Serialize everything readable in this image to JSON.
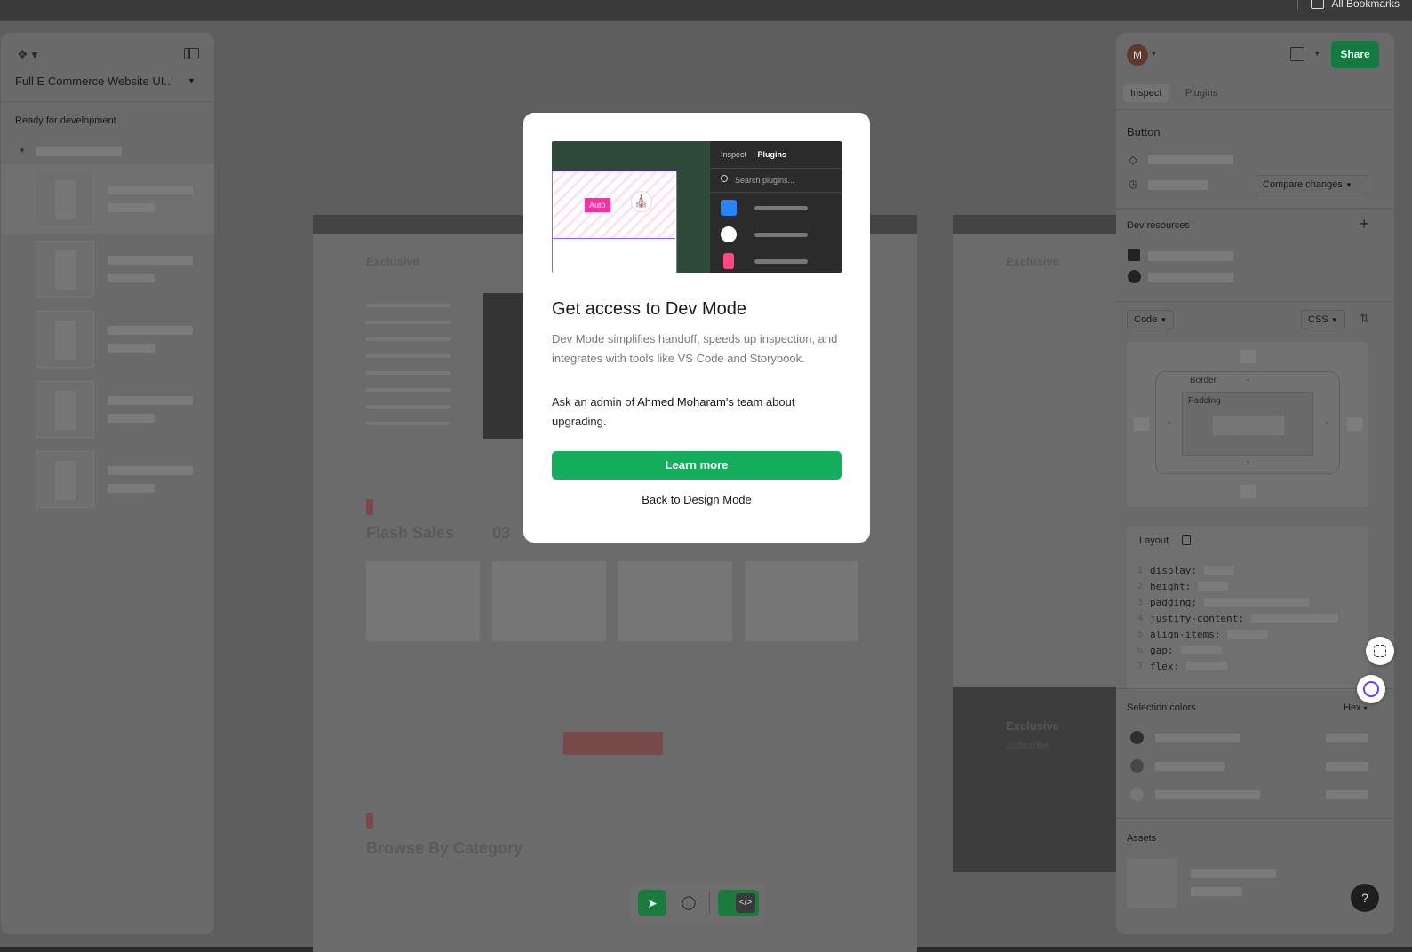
{
  "browser": {
    "bookmarks_label": "All Bookmarks"
  },
  "left_panel": {
    "file_title": "Full E Commerce Website UI...",
    "section": "Ready for development"
  },
  "right_panel": {
    "avatar_initial": "M",
    "share_label": "Share",
    "tabs": [
      "Inspect",
      "Plugins"
    ],
    "selection_title": "Button",
    "compare_label": "Compare changes",
    "dev_resources_label": "Dev resources",
    "code_label": "Code",
    "lang_label": "CSS",
    "box_border": "Border",
    "box_padding": "Padding",
    "box_dash": "-",
    "layout_label": "Layout",
    "code_lines": [
      {
        "n": "1",
        "t": "display:"
      },
      {
        "n": "2",
        "t": "height:"
      },
      {
        "n": "3",
        "t": "padding:"
      },
      {
        "n": "4",
        "t": "justify-content:"
      },
      {
        "n": "5",
        "t": "align-items:"
      },
      {
        "n": "6",
        "t": "gap:"
      },
      {
        "n": "7",
        "t": "flex:"
      }
    ],
    "selection_colors_label": "Selection colors",
    "color_format": "Hex",
    "assets_label": "Assets",
    "help_label": "?"
  },
  "modal": {
    "illus_tab_inspect": "Inspect",
    "illus_tab_plugins": "Plugins",
    "illus_search": "Search plugins...",
    "illus_auto": "Auto",
    "title": "Get access to Dev Mode",
    "description": "Dev Mode simplifies handoff, speeds up inspection, and integrates with tools like VS Code and Storybook.",
    "ask_prefix": "Ask an admin of ",
    "team": "Ahmed Moharam's team",
    "ask_suffix": " about upgrading.",
    "learn_more": "Learn more",
    "back": "Back to Design Mode"
  },
  "canvas": {
    "brand": "Exclusive",
    "flash_sales": "Flash Sales",
    "countdown": "03",
    "browse": "Browse By Category",
    "footer_brand": "Exclusive",
    "subscribe": "Subscribe"
  },
  "colors": {
    "accent_green": "#14ae5c",
    "share_green": "#157a3f",
    "auto_pink": "#ff2ea0"
  }
}
